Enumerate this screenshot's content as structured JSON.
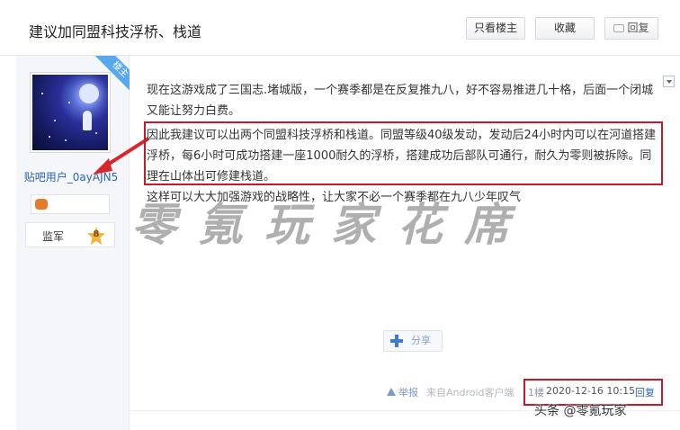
{
  "header": {
    "title": "建议加同盟科技浮桥、栈道",
    "only_author_label": "只看楼主",
    "collect_label": "收藏",
    "reply_label": "回复"
  },
  "author": {
    "badge": "楼主",
    "username": "贴吧用户_0ayAJN5",
    "rank_title": "监军",
    "rank_level": "8"
  },
  "post": {
    "paragraphs": [
      "现在这游戏成了三国志.堵城版，一个赛季都是在反复推九八，好不容易推进几十格，后面一个闭城又能让努力白费。",
      "因此我建议可以出两个同盟科技浮桥和栈道。同盟等级40级发动，发动后24小时内可以在河道搭建浮桥，每6小时可成功搭建一座1000耐久的浮桥，搭建成功后部队可通行，耐久为零则被拆除。同理在山体出可修建栈道。",
      "这样可以大大加强游戏的战略性，让大家不必一个赛季都在九八少年叹气"
    ],
    "watermark": "零氪玩家花席",
    "share_label": "分享",
    "report_label": "举报",
    "client_label": "来自Android客户端",
    "floor": "1楼",
    "time": "2020-12-16 10:15",
    "reply_label": "回复"
  },
  "footer": {
    "stamp": "头条 @零氪玩家"
  },
  "colors": {
    "highlight": "#c8182a",
    "link": "#2d64b3",
    "ribbon": "#59a8ee"
  }
}
